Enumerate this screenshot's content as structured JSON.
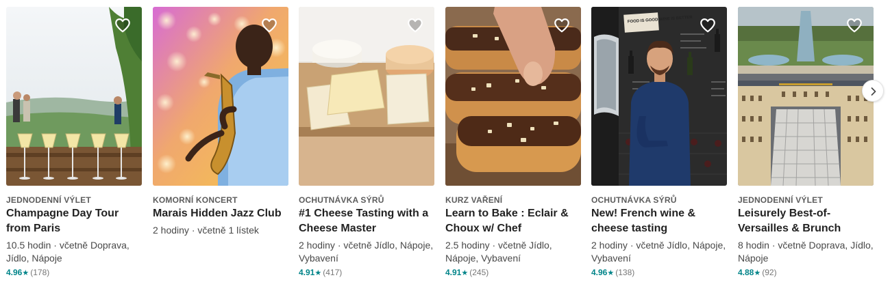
{
  "cards": [
    {
      "category": "JEDNODENNÍ VÝLET",
      "title": "Champagne Day Tour from Paris",
      "meta": "10.5 hodin · včetně Doprava, Jídlo, Nápoje",
      "rating": "4.96",
      "reviews": "(178)",
      "image": "champagne-vineyard-photo"
    },
    {
      "category": "KOMORNÍ KONCERT",
      "title": "Marais Hidden Jazz Club",
      "meta": "2 hodiny · včetně 1 lístek",
      "rating": "",
      "reviews": "",
      "image": "saxophone-player-photo"
    },
    {
      "category": "OCHUTNÁVKA SÝRŮ",
      "title": "#1 Cheese Tasting with a Cheese Master",
      "meta": "2 hodiny · včetně Jídlo, Nápoje, Vybavení",
      "rating": "4.91",
      "reviews": "(417)",
      "image": "cheese-board-photo"
    },
    {
      "category": "KURZ VAŘENÍ",
      "title": "Learn to Bake : Eclair & Choux w/ Chef",
      "meta": "2.5 hodiny · včetně Jídlo, Nápoje, Vybavení",
      "rating": "4.91",
      "reviews": "(245)",
      "image": "eclair-pastry-photo"
    },
    {
      "category": "OCHUTNÁVKA SÝRŮ",
      "title": "New! French wine & cheese tasting",
      "meta": "2 hodiny · včetně Jídlo, Nápoje, Vybavení",
      "rating": "4.96",
      "reviews": "(138)",
      "image": "wine-shop-host-photo"
    },
    {
      "category": "JEDNODENNÍ VÝLET",
      "title": "Leisurely Best-of-Versailles & Brunch",
      "meta": "8 hodin · včetně Doprava, Jídlo, Nápoje",
      "rating": "4.88",
      "reviews": "(92)",
      "image": "versailles-aerial-photo"
    }
  ],
  "sign_text": "FOOD IS GOOD WINE IS BETTER",
  "star_glyph": "★",
  "icons": {
    "favorite": "heart-outline-icon",
    "next": "chevron-right-icon"
  },
  "colors": {
    "rating": "#008489",
    "category": "#5c5c5c",
    "title": "#222222",
    "meta": "#484848"
  }
}
